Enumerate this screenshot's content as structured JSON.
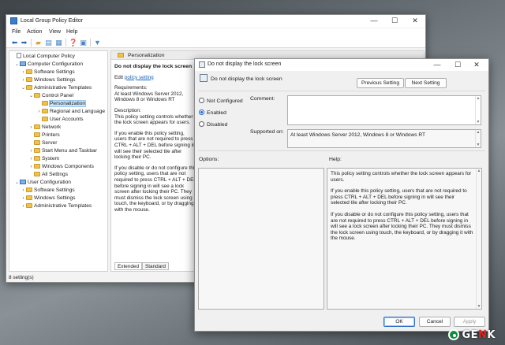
{
  "main_window": {
    "title": "Local Group Policy Editor",
    "controls": {
      "minimize": "—",
      "maximize": "☐",
      "close": "✕"
    },
    "menu": [
      "File",
      "Action",
      "View",
      "Help"
    ],
    "toolbar_icons": [
      "back-arrow-icon",
      "forward-arrow-icon",
      "up-folder-icon",
      "show-hide-tree-icon",
      "export-list-icon",
      "help-icon",
      "properties-icon",
      "filter-icon"
    ],
    "tree": [
      {
        "label": "Local Computer Policy",
        "level": 0,
        "icon": "doc",
        "arrow": ""
      },
      {
        "label": "Computer Configuration",
        "level": 1,
        "icon": "pc",
        "arrow": "⌄"
      },
      {
        "label": "Software Settings",
        "level": 2,
        "icon": "folder",
        "arrow": "›"
      },
      {
        "label": "Windows Settings",
        "level": 2,
        "icon": "folder",
        "arrow": "›"
      },
      {
        "label": "Administrative Templates",
        "level": 2,
        "icon": "folder",
        "arrow": "⌄"
      },
      {
        "label": "Control Panel",
        "level": 3,
        "icon": "folder",
        "arrow": "⌄"
      },
      {
        "label": "Personalization",
        "level": 4,
        "icon": "folder",
        "arrow": "",
        "selected": true
      },
      {
        "label": "Regional and Language",
        "level": 4,
        "icon": "folder",
        "arrow": "›"
      },
      {
        "label": "User Accounts",
        "level": 4,
        "icon": "folder",
        "arrow": ""
      },
      {
        "label": "Network",
        "level": 3,
        "icon": "folder",
        "arrow": "›"
      },
      {
        "label": "Printers",
        "level": 3,
        "icon": "folder",
        "arrow": ""
      },
      {
        "label": "Server",
        "level": 3,
        "icon": "folder",
        "arrow": ""
      },
      {
        "label": "Start Menu and Taskbar",
        "level": 3,
        "icon": "folder",
        "arrow": "›"
      },
      {
        "label": "System",
        "level": 3,
        "icon": "folder",
        "arrow": "›"
      },
      {
        "label": "Windows Components",
        "level": 3,
        "icon": "folder",
        "arrow": "›"
      },
      {
        "label": "All Settings",
        "level": 3,
        "icon": "folder",
        "arrow": ""
      },
      {
        "label": "User Configuration",
        "level": 1,
        "icon": "pc",
        "arrow": "⌄"
      },
      {
        "label": "Software Settings",
        "level": 2,
        "icon": "folder",
        "arrow": "›"
      },
      {
        "label": "Windows Settings",
        "level": 2,
        "icon": "folder",
        "arrow": "›"
      },
      {
        "label": "Administrative Templates",
        "level": 2,
        "icon": "folder",
        "arrow": "›"
      }
    ],
    "detail": {
      "header": "Personalization",
      "policy_title": "Do not display the lock screen",
      "edit_prefix": "Edit",
      "edit_link": "policy setting",
      "requirements_label": "Requirements:",
      "requirements": "At least Windows Server 2012, Windows 8 or Windows RT",
      "description_label": "Description:",
      "description_1": "This policy setting controls whether the lock screen appears for users.",
      "description_2": "If you enable this policy setting, users that are not required to press CTRL + ALT + DEL before signing in will see their selected tile after locking their PC.",
      "description_3": "If you disable or do not configure this policy setting, users that are not required to press CTRL + ALT + DEL before signing in will see a lock screen after locking their PC. They must dismiss the lock screen using touch, the keyboard, or by dragging it with the mouse."
    },
    "tabs": [
      "Extended",
      "Standard"
    ],
    "status": "8 setting(s)"
  },
  "dialog": {
    "title": "Do not display the lock screen",
    "controls": {
      "minimize": "—",
      "maximize": "☐",
      "close": "✕"
    },
    "policy_name": "Do not display the lock screen",
    "previous_button": "Previous Setting",
    "next_button": "Next Setting",
    "options": [
      {
        "label": "Not Configured",
        "checked": false
      },
      {
        "label": "Enabled",
        "checked": true
      },
      {
        "label": "Disabled",
        "checked": false
      }
    ],
    "comment_label": "Comment:",
    "comment_value": "",
    "supported_label": "Supported on:",
    "supported_value": "At least Windows Server 2012, Windows 8 or Windows RT",
    "options_label": "Options:",
    "help_label": "Help:",
    "help_1": "This policy setting controls whether the lock screen appears for users.",
    "help_2": "If you enable this policy setting, users that are not required to press CTRL + ALT + DEL before signing in will see their selected tile after locking their PC.",
    "help_3": "If you disable or do not configure this policy setting, users that are not required to press CTRL + ALT + DEL before signing in will see a lock screen after locking their PC. They must dismiss the lock screen using touch, the keyboard, or by dragging it with the mouse.",
    "ok_button": "OK",
    "cancel_button": "Cancel",
    "apply_button": "Apply"
  },
  "watermark": {
    "brand_ge": "GE",
    "brand_n": "N",
    "brand_k": "K"
  }
}
